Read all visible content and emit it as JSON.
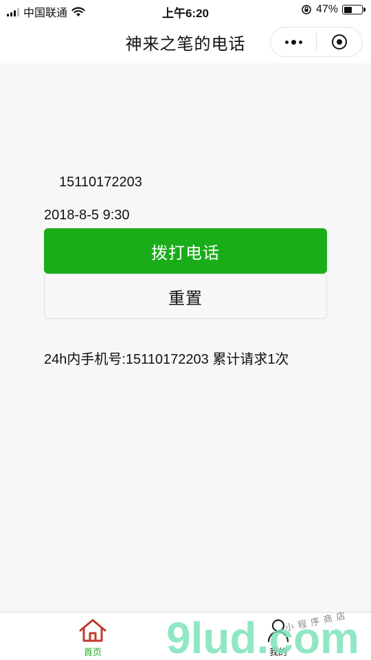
{
  "status_bar": {
    "carrier": "中国联通",
    "time": "上午6:20",
    "battery_percent": "47%",
    "battery_level": 0.47
  },
  "navbar": {
    "title": "神来之笔的电话"
  },
  "main": {
    "phone_number": "15110172203",
    "datetime": "2018-8-5 9:30",
    "call_button": "拨打电话",
    "reset_button": "重置",
    "request_info": "24h内手机号:15110172203 累计请求1次"
  },
  "tabbar": {
    "home_label": "首页",
    "mine_label": "我的"
  },
  "watermark": {
    "logo_text": "9lud.com",
    "sub_text": "小程序商店"
  },
  "colors": {
    "accent_green": "#1aad19",
    "background": "#f7f7f7",
    "home_icon": "#c0392b"
  }
}
